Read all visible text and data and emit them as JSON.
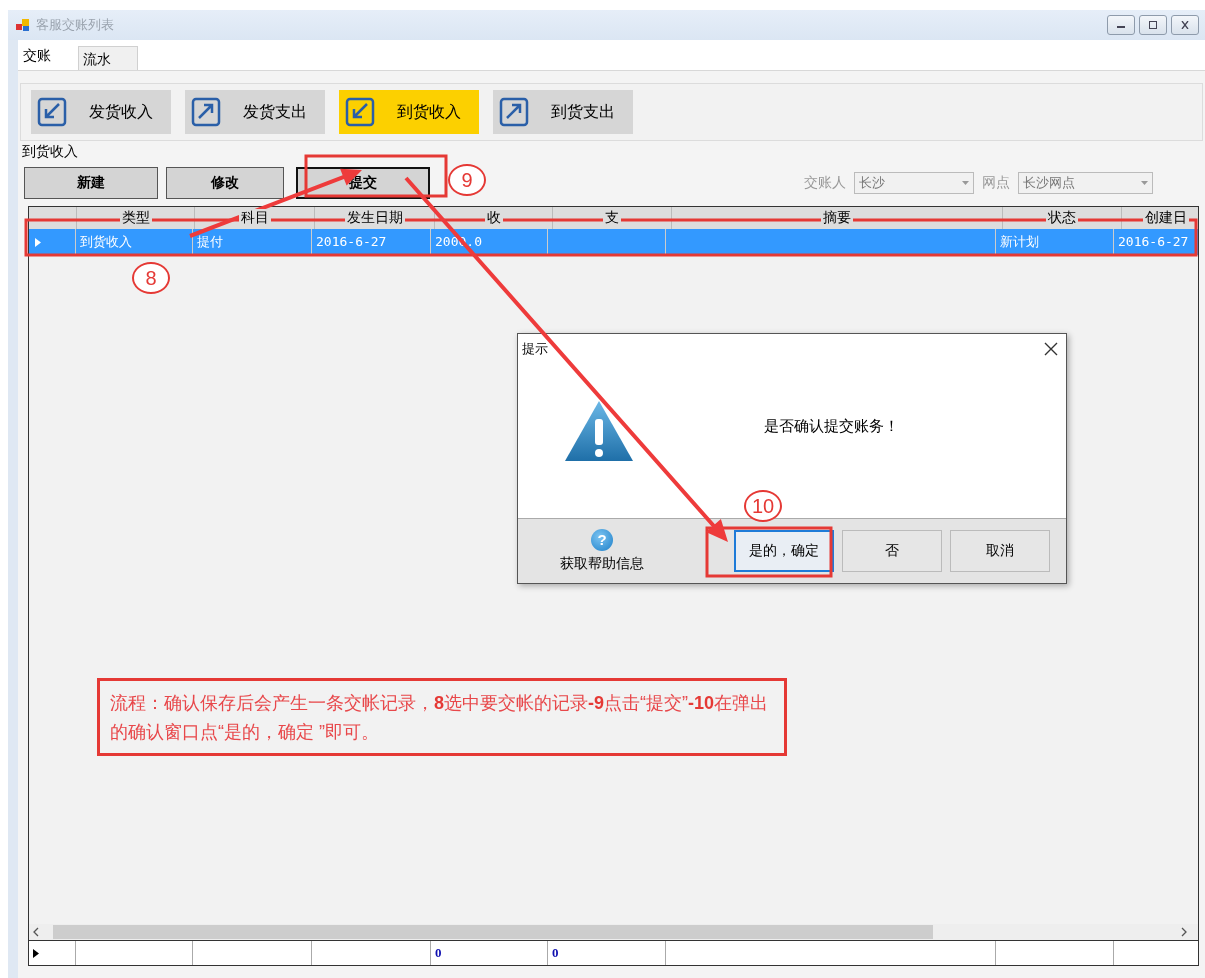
{
  "window": {
    "title": "客服交账列表"
  },
  "tabs": [
    {
      "label": "交账",
      "selected": true
    },
    {
      "label": "流水",
      "selected": false
    }
  ],
  "toolbar": [
    {
      "label": "发货收入",
      "kind": "in",
      "selected": false
    },
    {
      "label": "发货支出",
      "kind": "out",
      "selected": false
    },
    {
      "label": "到货收入",
      "kind": "in",
      "selected": true
    },
    {
      "label": "到货支出",
      "kind": "out",
      "selected": false
    }
  ],
  "group": {
    "title": "到货收入"
  },
  "actions": [
    {
      "label": "新建",
      "focused": false
    },
    {
      "label": "修改",
      "focused": false
    },
    {
      "label": "提交",
      "focused": true
    }
  ],
  "filters": [
    {
      "label": "交账人",
      "value": "长沙",
      "disabled": true
    },
    {
      "label": "网点",
      "value": "长沙网点",
      "disabled": true
    }
  ],
  "table": {
    "columns": [
      "类型",
      "科目",
      "发生日期",
      "收",
      "支",
      "摘要",
      "状态",
      "创建日"
    ],
    "rows": [
      {
        "selected": true,
        "type": "到货收入",
        "subject": "提付",
        "date": "2016-6-27",
        "in": "2000.0",
        "status": "新计划",
        "created": "2016-6-27"
      }
    ],
    "totals": {
      "in": "0",
      "out": "0"
    }
  },
  "dialog": {
    "title": "提示",
    "message": "是否确认提交账务！",
    "help_icon": "?",
    "help": "获取帮助信息",
    "buttons": [
      {
        "label": "是的，确定",
        "selected": true
      },
      {
        "label": "否",
        "selected": false
      },
      {
        "label": "取消",
        "selected": false
      }
    ]
  },
  "annotations": {
    "steps": [
      "8",
      "9",
      "10"
    ],
    "note": "流程：确认保存后会产生一条交帐记录，**8**选中要交帐的记录**-9**点击“提交”**-10**在弹出的确认窗口点“是的，确定 ”即可。"
  }
}
